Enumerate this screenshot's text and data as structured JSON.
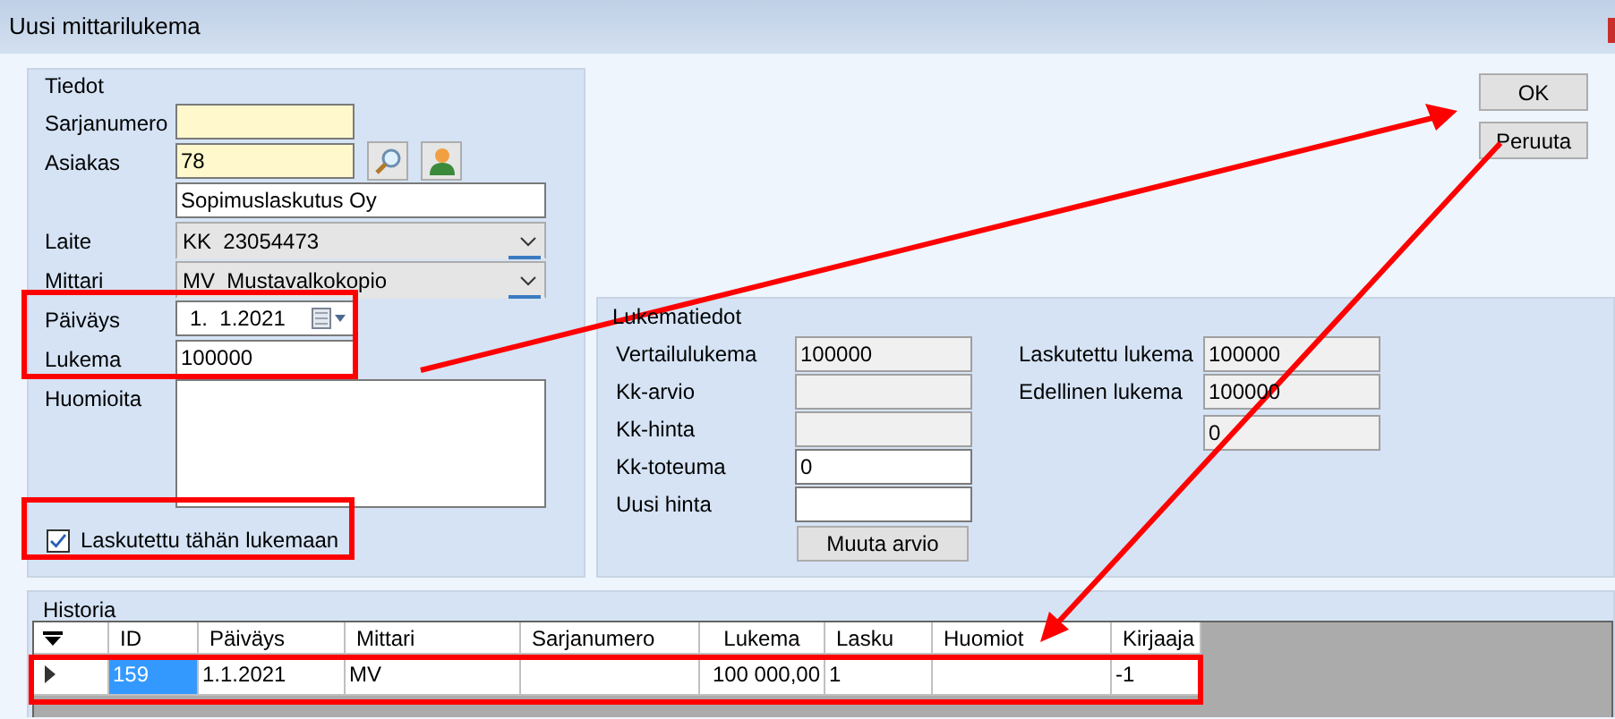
{
  "window": {
    "title": "Uusi mittarilukema"
  },
  "tiedot": {
    "title": "Tiedot",
    "fields": [
      {
        "kind": "text",
        "label": "Sarjanumero",
        "required": true
      },
      {
        "kind": "lookup",
        "label": "Asiakas",
        "value": "78",
        "required": true
      },
      {
        "kind": "text",
        "value": "Sopimuslaskutus Oy",
        "required": false
      },
      {
        "kind": "combo",
        "label": "Laite",
        "value": "KK  23054473"
      },
      {
        "kind": "combo",
        "label": "Mittari",
        "value": "MV  Mustavalkokopio"
      },
      {
        "kind": "date",
        "label": "Päiväys",
        "value": "1.  1.2021"
      },
      {
        "kind": "text",
        "label": "Lukema",
        "value": "100000",
        "required": false
      },
      {
        "kind": "memo",
        "label": "Huomioita"
      }
    ],
    "checkbox": {
      "label": "Laskutettu tähän lukemaan",
      "checked": true
    }
  },
  "buttons": [
    "OK",
    "Peruuta"
  ],
  "lukematiedot": {
    "title": "Lukematiedot",
    "left": [
      {
        "label": "Vertailulukema",
        "value": "100000",
        "readonly": true
      },
      {
        "label": "Kk-arvio",
        "readonly": true
      },
      {
        "label": "Kk-hinta",
        "readonly": true
      },
      {
        "label": "Kk-toteuma",
        "value": "0",
        "readonly": false
      },
      {
        "label": "Uusi hinta",
        "readonly": false
      }
    ],
    "button": "Muuta arvio",
    "right": [
      {
        "label": "Laskutettu lukema",
        "value": "100000",
        "readonly": true
      },
      {
        "label": "Edellinen lukema",
        "value": "100000",
        "readonly": true
      },
      {
        "value": "0",
        "readonly": true
      }
    ]
  },
  "historia": {
    "title": "Historia",
    "columns": [
      "ID",
      "Päiväys",
      "Mittari",
      "Sarjanumero",
      "Lukema",
      "Lasku",
      "Huomiot",
      "Kirjaaja"
    ],
    "rows": [
      {
        "selected": true,
        "cells": [
          {
            "text": "159",
            "selected": true
          },
          {
            "text": "1.1.2021",
            "selected": false
          },
          {
            "text": "MV",
            "selected": false
          },
          {
            "selected": false
          },
          {
            "text": "100 000,00",
            "selected": false
          },
          {
            "text": "1",
            "selected": false
          },
          {
            "selected": false
          },
          {
            "text": "-1",
            "selected": false
          }
        ]
      }
    ]
  }
}
